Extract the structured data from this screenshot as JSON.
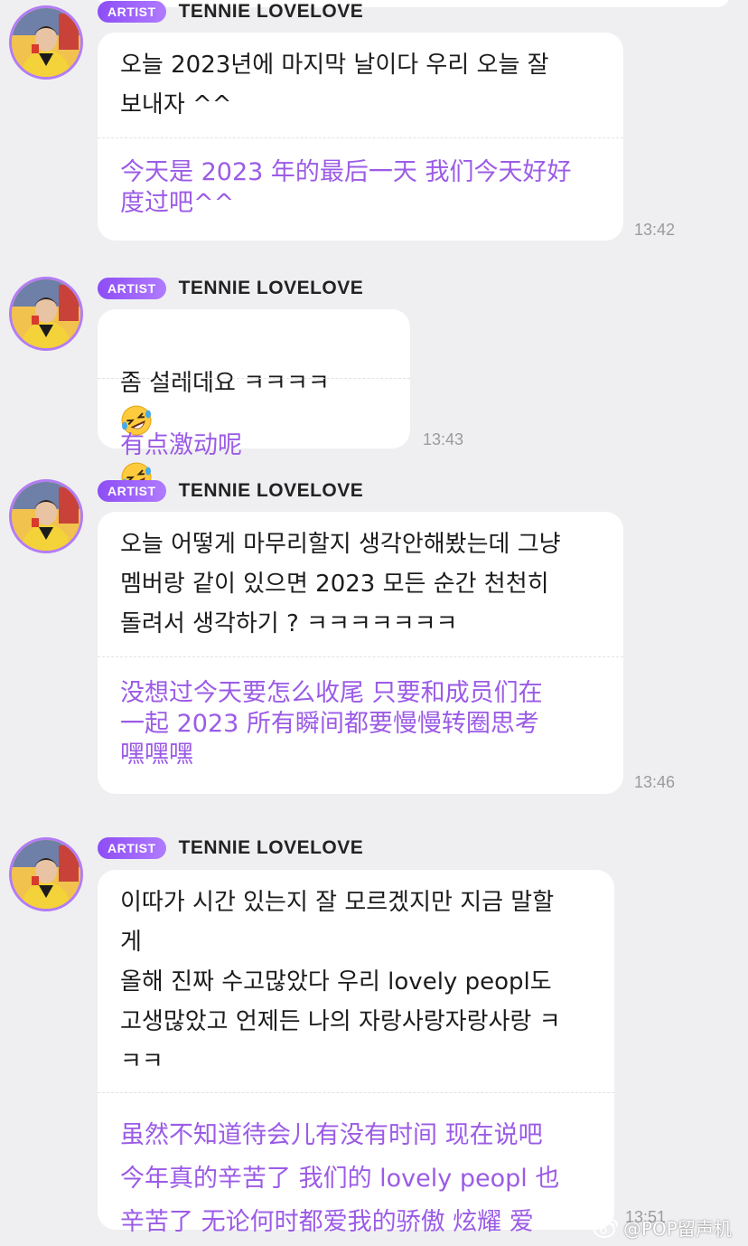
{
  "colors": {
    "background": "#efeff1",
    "bubble": "#ffffff",
    "translation_text": "#9b5be6",
    "badge": "#8d4df5",
    "avatar_ring": "#b27cf5"
  },
  "messages": [
    {
      "badge": "ARTIST",
      "sender": "TENNIE LOVELOVE",
      "original": "오늘 2023년에 마지막 날이다 우리 오늘 잘\n보내자 ^^",
      "translation": "今天是 2023 年的最后一天 我们今天好好\n度过吧^^",
      "time": "13:42"
    },
    {
      "badge": "ARTIST",
      "sender": "TENNIE LOVELOVE",
      "original": "좀 설레데요 ㅋㅋㅋㅋ",
      "original_emoji": "rolling-on-floor-laughing-emoji",
      "translation": "有点激动呢",
      "translation_emoji": "rolling-on-floor-laughing-emoji",
      "time": "13:43"
    },
    {
      "badge": "ARTIST",
      "sender": "TENNIE LOVELOVE",
      "original": "오늘 어떻게 마무리할지 생각안해봤는데 그냥\n멤버랑 같이 있으면 2023 모든 순간 천천히\n돌려서 생각하기 ? ㅋㅋㅋㅋㅋㅋㅋ",
      "translation": "没想过今天要怎么收尾 只要和成员们在\n一起 2023 所有瞬间都要慢慢转圈思考\n嘿嘿嘿",
      "time": "13:46"
    },
    {
      "badge": "ARTIST",
      "sender": "TENNIE LOVELOVE",
      "original": "이따가 시간 있는지 잘 모르겠지만 지금 말할\n게\n올해 진짜 수고많았다  우리 lovely peopl도\n고생많았고 언제든 나의 자랑사랑자랑사랑 ㅋ\nㅋㅋ",
      "translation": "虽然不知道待会儿有没有时间 现在说吧\n今年真的辛苦了  我们的 lovely peopl 也\n辛苦了 无论何时都爱我的骄傲 炫耀 爱",
      "time": "13:51"
    }
  ],
  "watermark": {
    "icon": "weibo-icon",
    "text": "@POP留声机"
  }
}
